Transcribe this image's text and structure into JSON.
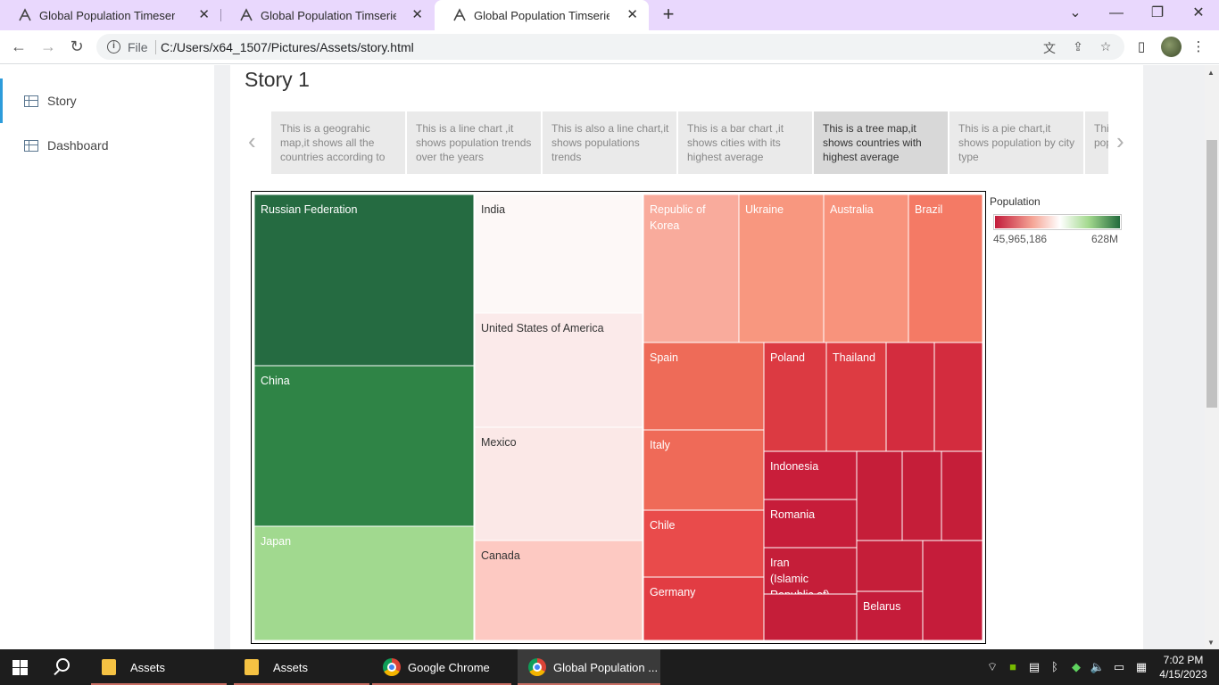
{
  "browser": {
    "tabs": [
      {
        "title": "Global Population Timeseries Analysis"
      },
      {
        "title": "Global Population Timseries Analysis"
      },
      {
        "title": "Global Population Timseries Analysis"
      }
    ],
    "new_tab_icon": "plus-icon",
    "url_scheme": "File",
    "url": "C:/Users/x64_1507/Pictures/Assets/story.html"
  },
  "sidebar": {
    "items": [
      {
        "label": "Story",
        "icon": "table-icon"
      },
      {
        "label": "Dashboard",
        "icon": "table-icon"
      }
    ]
  },
  "story": {
    "title": "Story 1",
    "points": [
      "This is a geograhic map,it shows all the countries according to",
      "This is a line chart ,it shows population trends over the years",
      "This is also a line chart,it shows populations trends",
      "This is a bar chart ,it shows cities with its highest average",
      "This is a tree map,it shows countries with highest average",
      "This is a pie chart,it shows population by city type",
      "This is a map, it explains population"
    ],
    "active_point": 4
  },
  "legend": {
    "title": "Population",
    "min_label": "45,965,186",
    "max_label": "628M",
    "colors": {
      "low": "#c21b3a",
      "mid": "#ffffff",
      "high": "#236b3c"
    }
  },
  "chart_data": {
    "type": "treemap",
    "measure": "Population",
    "color_range": [
      "45,965,186",
      "628M"
    ],
    "groups": [
      {
        "items": [
          {
            "label": "Russian Federation",
            "color": "#256b41"
          },
          {
            "label": "China",
            "color": "#2f8446"
          },
          {
            "label": "Japan",
            "color": "#a1d98f"
          }
        ]
      },
      {
        "items": [
          {
            "label": "India",
            "color": "#fdf8f7"
          },
          {
            "label": "United States of America",
            "color": "#fbeaea"
          },
          {
            "label": "Mexico",
            "color": "#fbe8e7"
          },
          {
            "label": "Canada",
            "color": "#fdc9c2"
          }
        ]
      },
      {
        "items": [
          {
            "label": "Republic of Korea",
            "color": "#f9ab9c"
          },
          {
            "label": "Ukraine",
            "color": "#f8977f"
          },
          {
            "label": "Australia",
            "color": "#f8937c"
          },
          {
            "label": "Brazil",
            "color": "#f47a65"
          },
          {
            "label": "Spain",
            "color": "#ee6b58"
          },
          {
            "label": "Poland",
            "color": "#dc3a42"
          },
          {
            "label": "Thailand",
            "color": "#dd3b42"
          },
          {
            "label": "",
            "color": "#d32c3e"
          },
          {
            "label": "",
            "color": "#d32c3e"
          },
          {
            "label": "Italy",
            "color": "#ef6a58"
          },
          {
            "label": "Indonesia",
            "color": "#c91e3a"
          },
          {
            "label": "",
            "color": "#c51e39"
          },
          {
            "label": "",
            "color": "#c51e39"
          },
          {
            "label": "",
            "color": "#c51e39"
          },
          {
            "label": "Chile",
            "color": "#e94b4b"
          },
          {
            "label": "Romania",
            "color": "#c71d3a"
          },
          {
            "label": "Germany",
            "color": "#e23c43"
          },
          {
            "label": "Iran (Islamic Republic of)",
            "color": "#c51e39"
          },
          {
            "label": "",
            "color": "#c51e39"
          },
          {
            "label": "",
            "color": "#c51e39"
          },
          {
            "label": "Belarus",
            "color": "#c51c3a"
          },
          {
            "label": "",
            "color": "#c51c3a"
          }
        ]
      }
    ]
  },
  "taskbar": {
    "items": [
      {
        "label": "Assets",
        "icon": "folder-icon"
      },
      {
        "label": "Assets",
        "icon": "folder-icon"
      },
      {
        "label": "Google Chrome",
        "icon": "chrome-icon"
      },
      {
        "label": "Global Population ...",
        "icon": "chrome-icon"
      }
    ],
    "time": "7:02 PM",
    "date": "4/15/2023"
  }
}
